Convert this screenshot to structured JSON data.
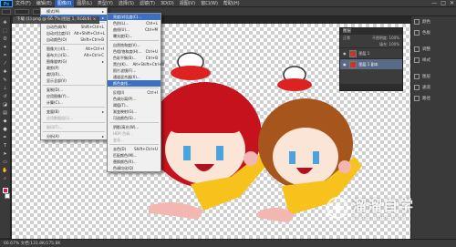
{
  "app": {
    "logo": "Ps"
  },
  "menubar": {
    "items": [
      "文件(F)",
      "编辑(E)",
      "图像(I)",
      "图层(L)",
      "类型(Y)",
      "选择(S)",
      "滤镜(T)",
      "3D(D)",
      "视图(V)",
      "窗口(W)",
      "帮助(H)"
    ],
    "active_index": 2
  },
  "window_controls": {
    "minimize": "—",
    "restore": "□",
    "close": "✕"
  },
  "document_tab": {
    "title": "下载 (1).png @ 66.7%(图层 1, RGB/8) ×"
  },
  "image_menu": {
    "items": [
      {
        "label": "模式(M)",
        "shortcut": "▸",
        "state": "normal"
      },
      {
        "label": "调整(J)",
        "shortcut": "▸",
        "state": "highlighted"
      },
      {
        "sep": true
      },
      {
        "label": "自动色调(N)",
        "shortcut": "Shift+Ctrl+L",
        "state": "normal"
      },
      {
        "label": "自动对比度(U)",
        "shortcut": "Alt+Shift+Ctrl+L",
        "state": "normal"
      },
      {
        "label": "自动颜色(O)",
        "shortcut": "Shift+Ctrl+B",
        "state": "normal"
      },
      {
        "sep": true
      },
      {
        "label": "图像大小(I)...",
        "shortcut": "Alt+Ctrl+I",
        "state": "normal"
      },
      {
        "label": "画布大小(S)...",
        "shortcut": "Alt+Ctrl+C",
        "state": "normal"
      },
      {
        "label": "图像旋转(G)",
        "shortcut": "▸",
        "state": "normal"
      },
      {
        "label": "裁剪(P)",
        "shortcut": "",
        "state": "normal"
      },
      {
        "label": "裁切(R)...",
        "shortcut": "",
        "state": "normal"
      },
      {
        "label": "显示全部(V)",
        "shortcut": "",
        "state": "normal"
      },
      {
        "sep": true
      },
      {
        "label": "复制(D)...",
        "shortcut": "",
        "state": "normal"
      },
      {
        "label": "应用图像(Y)...",
        "shortcut": "",
        "state": "normal"
      },
      {
        "label": "计算(C)...",
        "shortcut": "",
        "state": "normal"
      },
      {
        "sep": true
      },
      {
        "label": "变量(B)",
        "shortcut": "▸",
        "state": "normal"
      },
      {
        "label": "应用数据组(L)...",
        "shortcut": "",
        "state": "disabled"
      },
      {
        "sep": true
      },
      {
        "label": "陷印(T)...",
        "shortcut": "",
        "state": "disabled"
      },
      {
        "sep": true
      },
      {
        "label": "分析(A)",
        "shortcut": "▸",
        "state": "normal"
      }
    ]
  },
  "adjust_menu": {
    "items": [
      {
        "label": "亮度/对比度(C)...",
        "shortcut": "",
        "state": "highlighted"
      },
      {
        "label": "色阶(L)...",
        "shortcut": "Ctrl+L",
        "state": "normal"
      },
      {
        "label": "曲线(U)...",
        "shortcut": "Ctrl+M",
        "state": "normal"
      },
      {
        "label": "曝光度(E)...",
        "shortcut": "",
        "state": "normal"
      },
      {
        "sep": true
      },
      {
        "label": "自然饱和度(V)...",
        "shortcut": "",
        "state": "normal"
      },
      {
        "label": "色相/饱和度(H)...",
        "shortcut": "Ctrl+U",
        "state": "normal"
      },
      {
        "label": "色彩平衡(B)...",
        "shortcut": "Ctrl+B",
        "state": "normal"
      },
      {
        "label": "黑白(K)...",
        "shortcut": "Alt+Shift+Ctrl+B",
        "state": "normal"
      },
      {
        "label": "照片滤镜(F)...",
        "shortcut": "",
        "state": "normal"
      },
      {
        "label": "通道混合器(X)...",
        "shortcut": "",
        "state": "normal"
      },
      {
        "label": "颜色查找...",
        "shortcut": "",
        "state": "highlighted"
      },
      {
        "sep": true
      },
      {
        "label": "反相(I)",
        "shortcut": "Ctrl+I",
        "state": "normal"
      },
      {
        "label": "色调分离(P)...",
        "shortcut": "",
        "state": "normal"
      },
      {
        "label": "阈值(T)...",
        "shortcut": "",
        "state": "normal"
      },
      {
        "label": "渐变映射(G)...",
        "shortcut": "",
        "state": "normal"
      },
      {
        "label": "可选颜色(S)...",
        "shortcut": "",
        "state": "normal"
      },
      {
        "sep": true
      },
      {
        "label": "阴影/高光(W)...",
        "shortcut": "",
        "state": "normal"
      },
      {
        "label": "HDR 色调...",
        "shortcut": "",
        "state": "disabled"
      },
      {
        "label": "变化...",
        "shortcut": "",
        "state": "disabled"
      },
      {
        "sep": true
      },
      {
        "label": "去色(D)",
        "shortcut": "Shift+Ctrl+U",
        "state": "normal"
      },
      {
        "label": "匹配颜色(M)...",
        "shortcut": "",
        "state": "normal"
      },
      {
        "label": "替换颜色(R)...",
        "shortcut": "",
        "state": "normal"
      },
      {
        "label": "色调均化(Q)",
        "shortcut": "",
        "state": "normal"
      }
    ]
  },
  "layers_panel": {
    "title": "图层",
    "blend_mode": "正常",
    "opacity_label": "不透明度: 100%",
    "fill_label": "填充: 100%",
    "layers": [
      {
        "name": "图层 1",
        "selected": false,
        "thumb": "img"
      },
      {
        "name": "图层 1 副本",
        "selected": true,
        "thumb": "img"
      }
    ]
  },
  "right_dock": {
    "items": [
      {
        "label": "颜色",
        "icon": "color-icon"
      },
      {
        "label": "色板",
        "icon": "swatches-icon"
      },
      {
        "label": "调整",
        "icon": "adjustments-icon"
      },
      {
        "label": "样式",
        "icon": "styles-icon"
      },
      {
        "label": "图层",
        "icon": "layers-icon"
      },
      {
        "label": "通道",
        "icon": "channels-icon"
      },
      {
        "label": "路径",
        "icon": "paths-icon"
      }
    ]
  },
  "statusbar": {
    "text": "66.67%    文档:131.8K/175.8K"
  },
  "colors": {
    "foreground": "#e8134f",
    "background": "#ffffff",
    "highlight": "#3d6fc2"
  },
  "watermark": {
    "title": "溜溜自学",
    "url": "ZIXUE.3D66.COM"
  }
}
